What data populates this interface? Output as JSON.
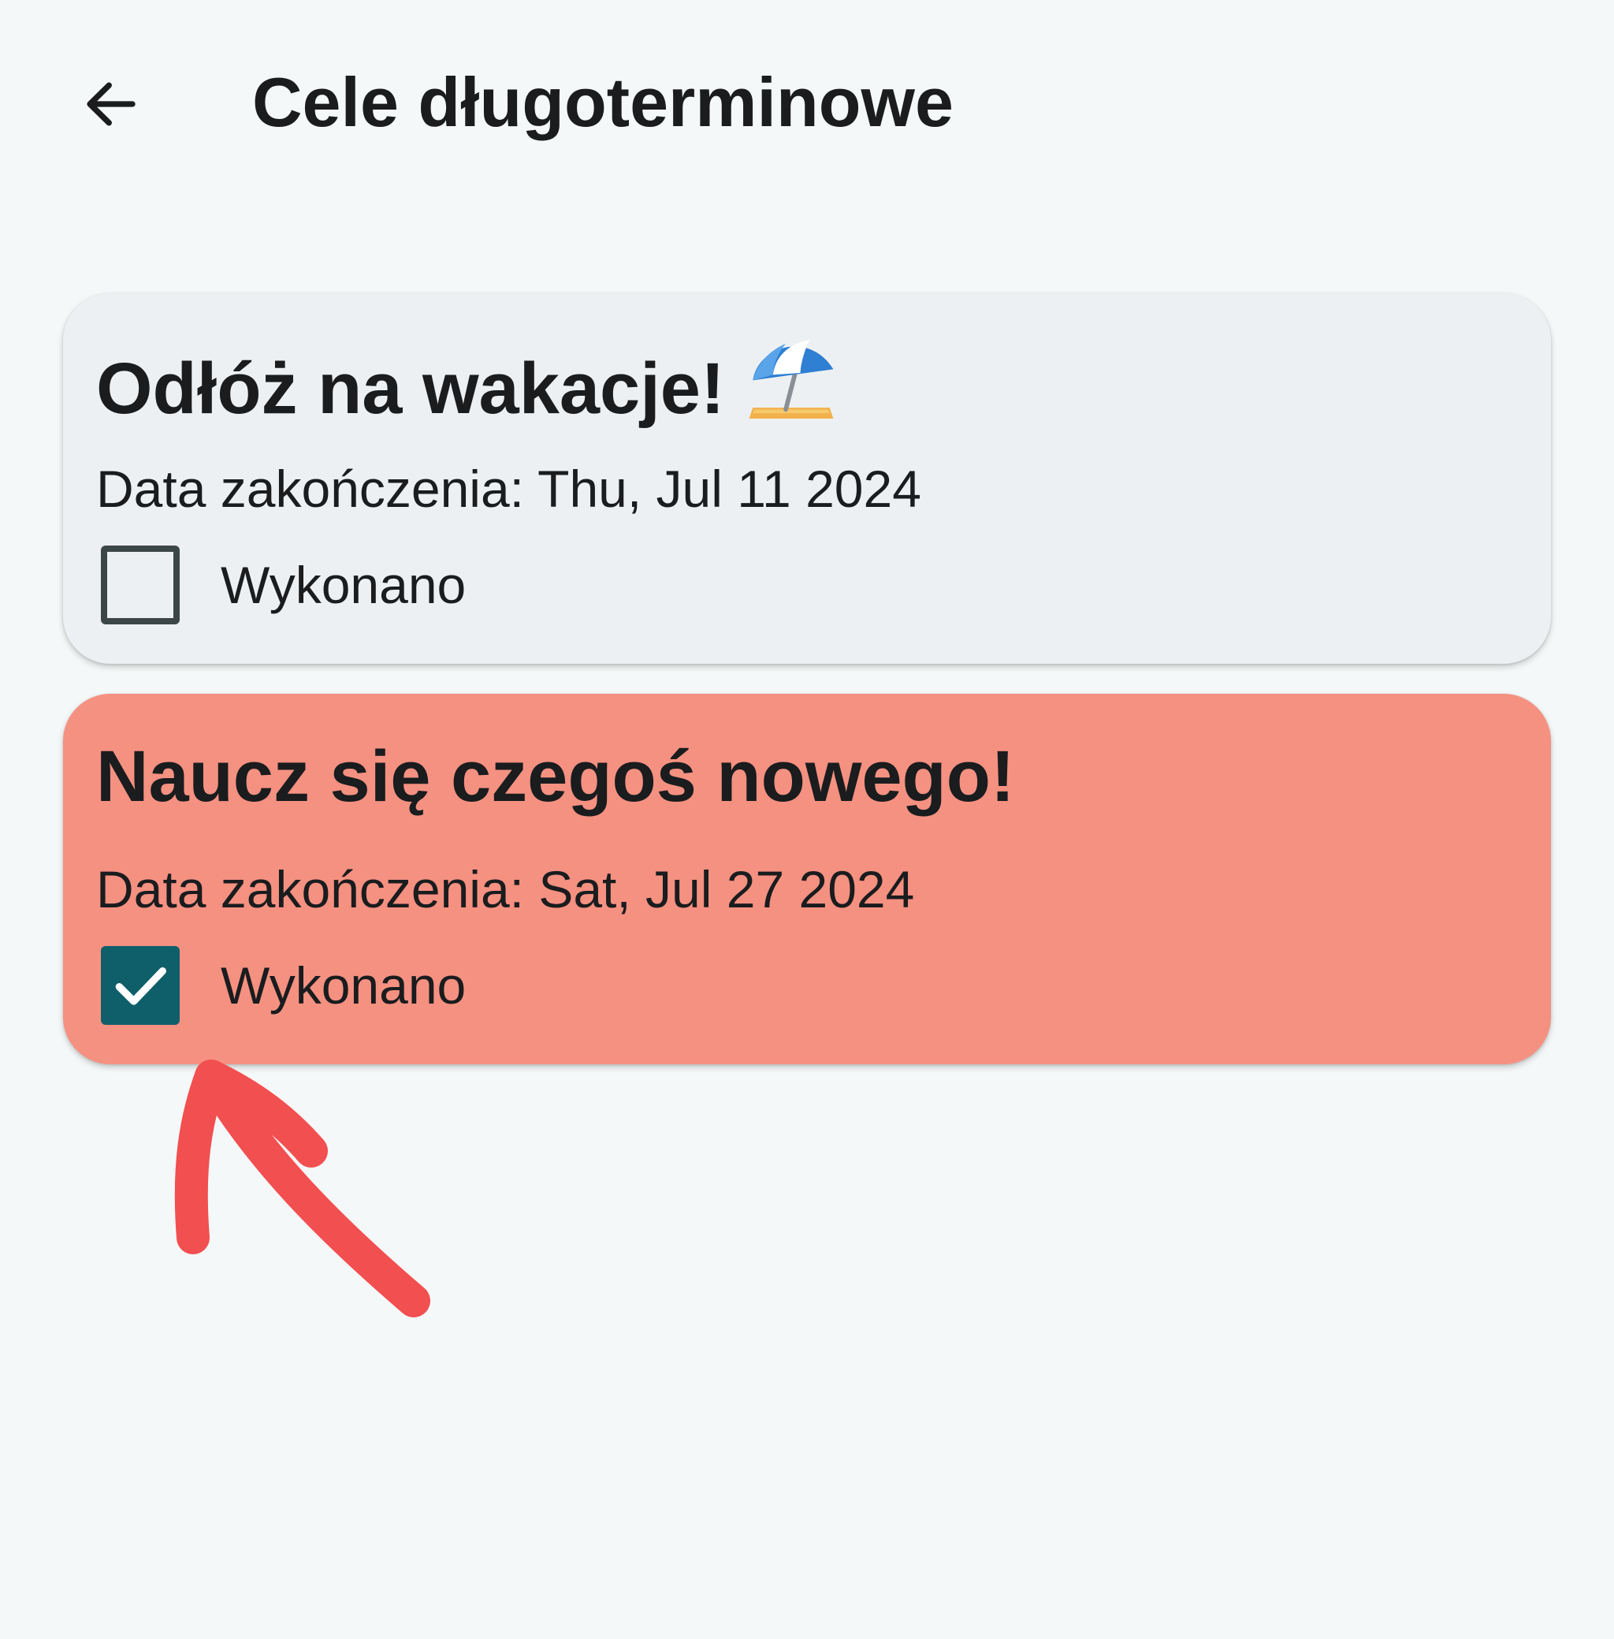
{
  "header": {
    "back_icon": "arrow-back-icon",
    "title": "Cele długoterminowe"
  },
  "goals": [
    {
      "title": "Odłóż na wakacje!",
      "emoji_icon": "beach-umbrella-icon",
      "date_text": "Data zakończenia: Thu, Jul 11 2024",
      "done_label": "Wykonano",
      "done": false,
      "card_color": "#edf0f2"
    },
    {
      "title": "Naucz się czegoś nowego!",
      "date_text": "Data zakończenia: Sat, Jul 27 2024",
      "done_label": "Wykonano",
      "done": true,
      "card_color": "#f59181"
    }
  ],
  "colors": {
    "background": "#f5f8f8",
    "checkbox_checked": "#0f5f6a",
    "annotation_arrow": "#f24f50"
  }
}
